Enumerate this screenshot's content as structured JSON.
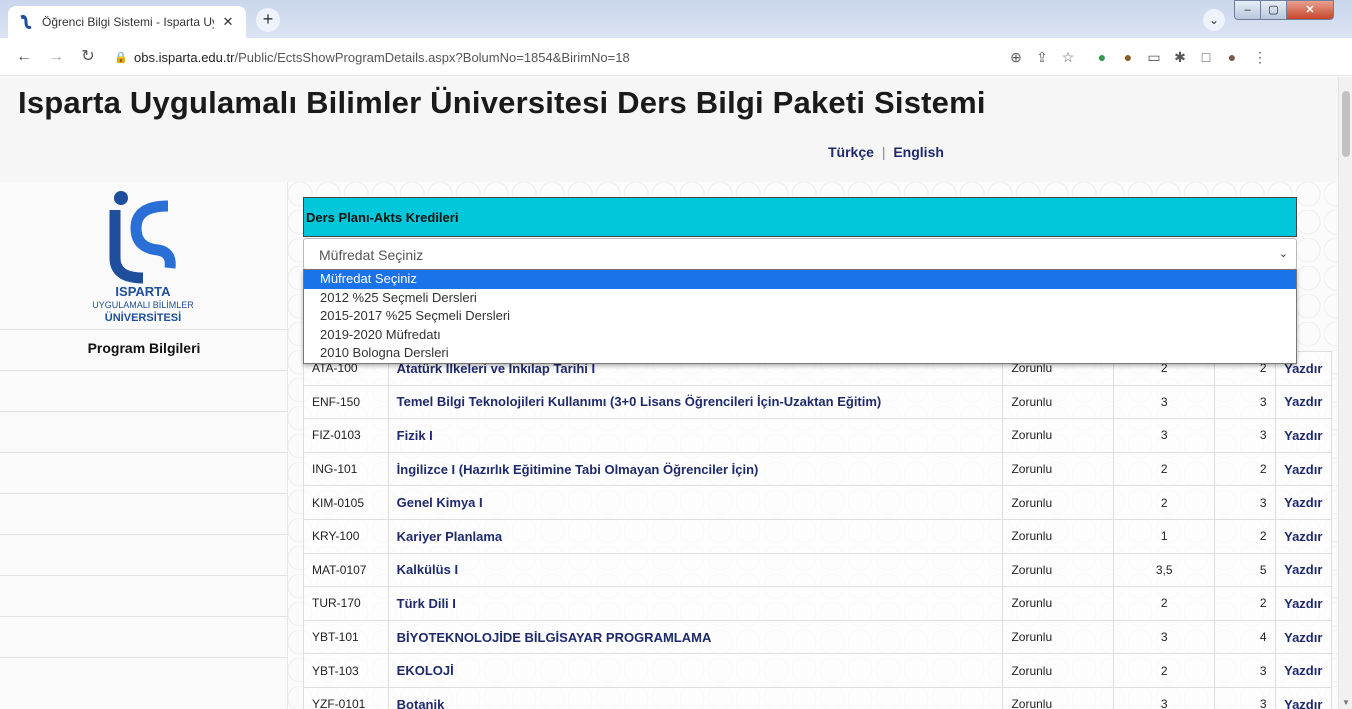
{
  "browser": {
    "tab_title": "Öğrenci Bilgi Sistemi - Isparta Uy",
    "url_host": "obs.isparta.edu.tr",
    "url_path": "/Public/EctsShowProgramDetails.aspx?BolumNo=1854&BirimNo=18"
  },
  "header": {
    "title": "Isparta Uygulamalı Bilimler Üniversitesi Ders Bilgi Paketi Sistemi",
    "lang_tr": "Türkçe",
    "lang_sep": "|",
    "lang_en": "English"
  },
  "sidebar": {
    "logo_line1": "ISPARTA",
    "logo_line2": "UYGULAMALI BİLİMLER",
    "logo_line3": "ÜNİVERSİTESİ",
    "program_title": "Program Bilgileri"
  },
  "main": {
    "panel_title": "Ders Planı-Akts Kredileri",
    "select_value": "Müfredat Seçiniz",
    "options": [
      "Müfredat Seçiniz",
      "2012 %25 Seçmeli Dersleri",
      "2015-2017 %25 Seçmeli Dersleri",
      "2019-2020 Müfredatı",
      "2010 Bologna Dersleri"
    ],
    "courses": [
      {
        "code": "ATA-100",
        "name": "Atatürk İlkeleri ve İnkılap Tarihi I",
        "type": "Zorunlu",
        "n1": "2",
        "n2": "2",
        "action": "Yazdır"
      },
      {
        "code": "ENF-150",
        "name": "Temel Bilgi Teknolojileri Kullanımı (3+0 Lisans Öğrencileri İçin-Uzaktan Eğitim)",
        "type": "Zorunlu",
        "n1": "3",
        "n2": "3",
        "action": "Yazdır"
      },
      {
        "code": "FIZ-0103",
        "name": "Fizik I",
        "type": "Zorunlu",
        "n1": "3",
        "n2": "3",
        "action": "Yazdır"
      },
      {
        "code": "ING-101",
        "name": "İngilizce I (Hazırlık Eğitimine Tabi Olmayan Öğrenciler İçin)",
        "type": "Zorunlu",
        "n1": "2",
        "n2": "2",
        "action": "Yazdır"
      },
      {
        "code": "KIM-0105",
        "name": "Genel Kimya I",
        "type": "Zorunlu",
        "n1": "2",
        "n2": "3",
        "action": "Yazdır"
      },
      {
        "code": "KRY-100",
        "name": "Kariyer Planlama",
        "type": "Zorunlu",
        "n1": "1",
        "n2": "2",
        "action": "Yazdır"
      },
      {
        "code": "MAT-0107",
        "name": "Kalkülüs I",
        "type": "Zorunlu",
        "n1": "3,5",
        "n2": "5",
        "action": "Yazdır"
      },
      {
        "code": "TUR-170",
        "name": "Türk Dili I",
        "type": "Zorunlu",
        "n1": "2",
        "n2": "2",
        "action": "Yazdır"
      },
      {
        "code": "YBT-101",
        "name": "BİYOTEKNOLOJİDE BİLGİSAYAR PROGRAMLAMA",
        "type": "Zorunlu",
        "n1": "3",
        "n2": "4",
        "action": "Yazdır"
      },
      {
        "code": "YBT-103",
        "name": "EKOLOJİ",
        "type": "Zorunlu",
        "n1": "2",
        "n2": "3",
        "action": "Yazdır"
      },
      {
        "code": "YZF-0101",
        "name": "Botanik",
        "type": "Zorunlu",
        "n1": "3",
        "n2": "3",
        "action": "Yazdır"
      }
    ]
  }
}
